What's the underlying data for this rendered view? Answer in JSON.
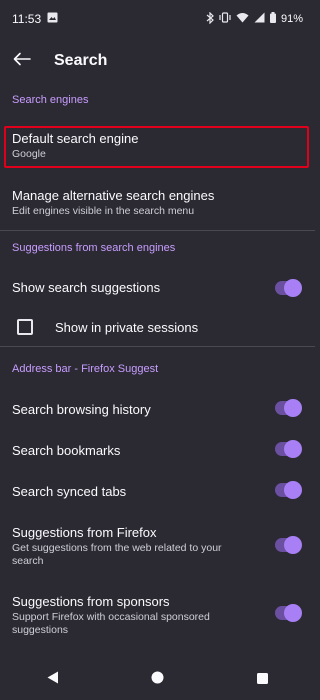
{
  "status_bar": {
    "time": "11:53",
    "battery": "91%",
    "icons": [
      "photo-notification-icon",
      "bluetooth-icon",
      "vibrate-icon",
      "wifi-icon",
      "signal-icon",
      "battery-icon"
    ]
  },
  "app_bar": {
    "title": "Search",
    "back_icon": "arrow-left-icon"
  },
  "sections": {
    "search_engines": "Search engines",
    "suggestions": "Suggestions from search engines",
    "address_bar": "Address bar - Firefox Suggest"
  },
  "search_engines": {
    "default_title": "Default search engine",
    "default_value": "Google",
    "manage_title": "Manage alternative search engines",
    "manage_sub": "Edit engines visible in the search menu"
  },
  "suggestions": {
    "show_suggestions": "Show search suggestions",
    "show_suggestions_on": true,
    "private_sessions": "Show in private sessions",
    "private_sessions_checked": false
  },
  "address_bar": {
    "browsing_history": "Search browsing history",
    "bookmarks": "Search bookmarks",
    "synced_tabs": "Search synced tabs",
    "firefox_title": "Suggestions from Firefox",
    "firefox_sub": "Get suggestions from the web related to your search",
    "sponsors_title": "Suggestions from sponsors",
    "sponsors_sub": "Support Firefox with occasional sponsored suggestions"
  },
  "colors": {
    "background": "#2b2a33",
    "accent": "#a87ff5",
    "section_header": "#c89dff",
    "highlight": "#e0001b"
  }
}
